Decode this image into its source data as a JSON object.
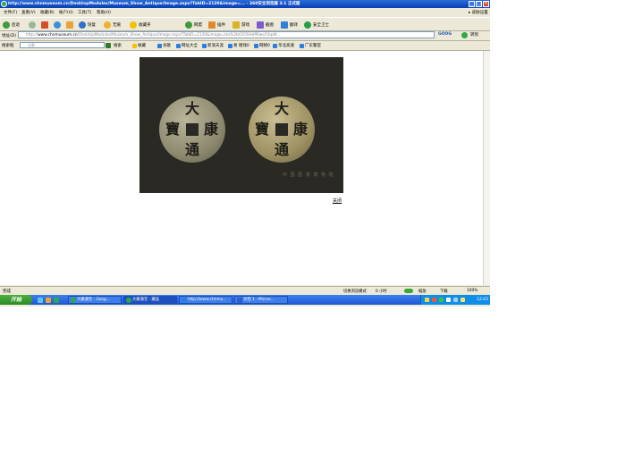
{
  "window": {
    "title": "http://www.chnmuseum.cn/DesktopModules/Museum_Show_Antique/Image.aspx?TabID=2120&image=...  - 360安全浏览器 3.1 正式版",
    "minimize": "_",
    "maximize": "□",
    "close": "×"
  },
  "menu": {
    "items": [
      "文件(F)",
      "查看(V)",
      "收藏(B)",
      "帐户(U)",
      "工具(T)",
      "帮助(H)"
    ],
    "right": "▸ 皮肤设置"
  },
  "toolbar": {
    "back": "后退",
    "forward": "",
    "stop": "",
    "refresh": "",
    "home": "",
    "restore": "恢复",
    "no_ads": "无痕",
    "favorites": "收藏夹",
    "tools": [
      "网盟",
      "插件",
      "游戏",
      "截图",
      "翻译"
    ],
    "security": "安全卫士"
  },
  "address": {
    "label": "地址(D)",
    "host": "www.chnmuseum.cn",
    "url_tail": "/DesktopModules/Museum_Show_Antique/Image.aspx?TabID=2120&image=Ho%2bV2OSHdP6ws/CbpW...",
    "engine": "GOOG",
    "go": "转到"
  },
  "favbar": {
    "search_label": "搜索框",
    "search_placeholder": "谷歌",
    "search_button": "搜索",
    "items": [
      "收藏",
      "谷歌",
      "网址大全",
      "新浪天涯",
      "易 唱戏0",
      "网络0",
      "华北高速",
      "广东警官"
    ]
  },
  "page": {
    "coin_characters": [
      "大",
      "康",
      "寶",
      "通"
    ],
    "watermark": "中 国 国 家 博 物 馆",
    "close_link": "关闭"
  },
  "status": {
    "left": "完成",
    "right": [
      "切换浏览模式",
      "0 小时",
      "缩放",
      "下载",
      "100%"
    ]
  },
  "taskbar": {
    "start": "开始",
    "tasks": [
      "大康通宝 - Goog...",
      "大康通宝 - 藏品",
      "http://www.chnmu...",
      "文档 1 - Micros..."
    ],
    "clock": "12:03"
  }
}
